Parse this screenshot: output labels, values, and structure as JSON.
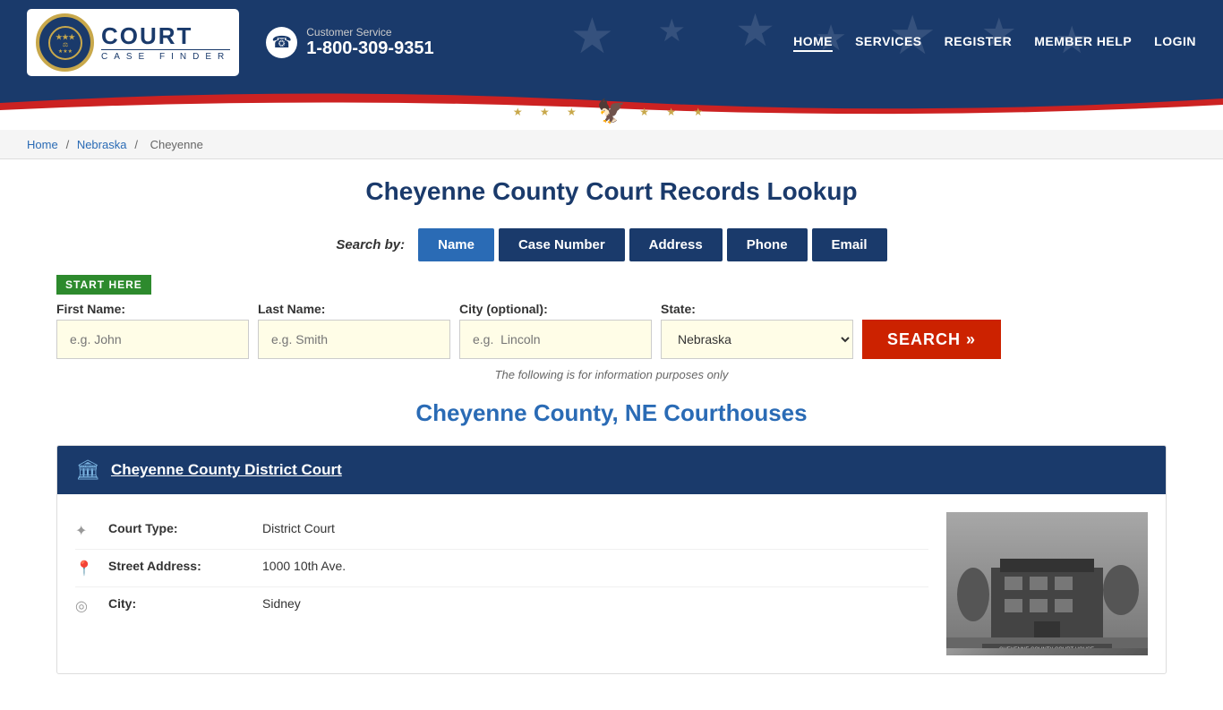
{
  "header": {
    "logo": {
      "court_word": "COURT",
      "case_finder_word": "CASE FINDER"
    },
    "customer_service": {
      "label": "Customer Service",
      "phone": "1-800-309-9351"
    },
    "nav": {
      "items": [
        {
          "label": "HOME",
          "active": true
        },
        {
          "label": "SERVICES",
          "active": false
        },
        {
          "label": "REGISTER",
          "active": false
        },
        {
          "label": "MEMBER HELP",
          "active": false
        },
        {
          "label": "LOGIN",
          "active": false
        }
      ]
    },
    "eagle_stars": "★ ★ ★ ★ ★ ★ ★"
  },
  "breadcrumb": {
    "home": "Home",
    "state": "Nebraska",
    "county": "Cheyenne"
  },
  "search_section": {
    "page_title": "Cheyenne County Court Records Lookup",
    "search_by_label": "Search by:",
    "tabs": [
      {
        "label": "Name",
        "active": true
      },
      {
        "label": "Case Number",
        "active": false
      },
      {
        "label": "Address",
        "active": false
      },
      {
        "label": "Phone",
        "active": false
      },
      {
        "label": "Email",
        "active": false
      }
    ],
    "start_here": "START HERE",
    "form": {
      "first_name_label": "First Name:",
      "first_name_placeholder": "e.g. John",
      "last_name_label": "Last Name:",
      "last_name_placeholder": "e.g. Smith",
      "city_label": "City (optional):",
      "city_placeholder": "e.g.  Lincoln",
      "state_label": "State:",
      "state_value": "Nebraska",
      "search_button": "SEARCH »"
    },
    "info_note": "The following is for information purposes only"
  },
  "courthouses_section": {
    "title": "Cheyenne County, NE Courthouses",
    "courthouses": [
      {
        "name": "Cheyenne County District Court",
        "court_type_label": "Court Type:",
        "court_type_value": "District Court",
        "street_address_label": "Street Address:",
        "street_address_value": "1000 10th Ave.",
        "city_label": "City:",
        "city_value": "Sidney"
      }
    ]
  },
  "icons": {
    "phone": "☎",
    "building": "🏛",
    "gavel": "⚖",
    "location_pin": "📍",
    "map_marker": "◎",
    "arrow": "✦",
    "eagle": "🦅",
    "star": "★"
  }
}
